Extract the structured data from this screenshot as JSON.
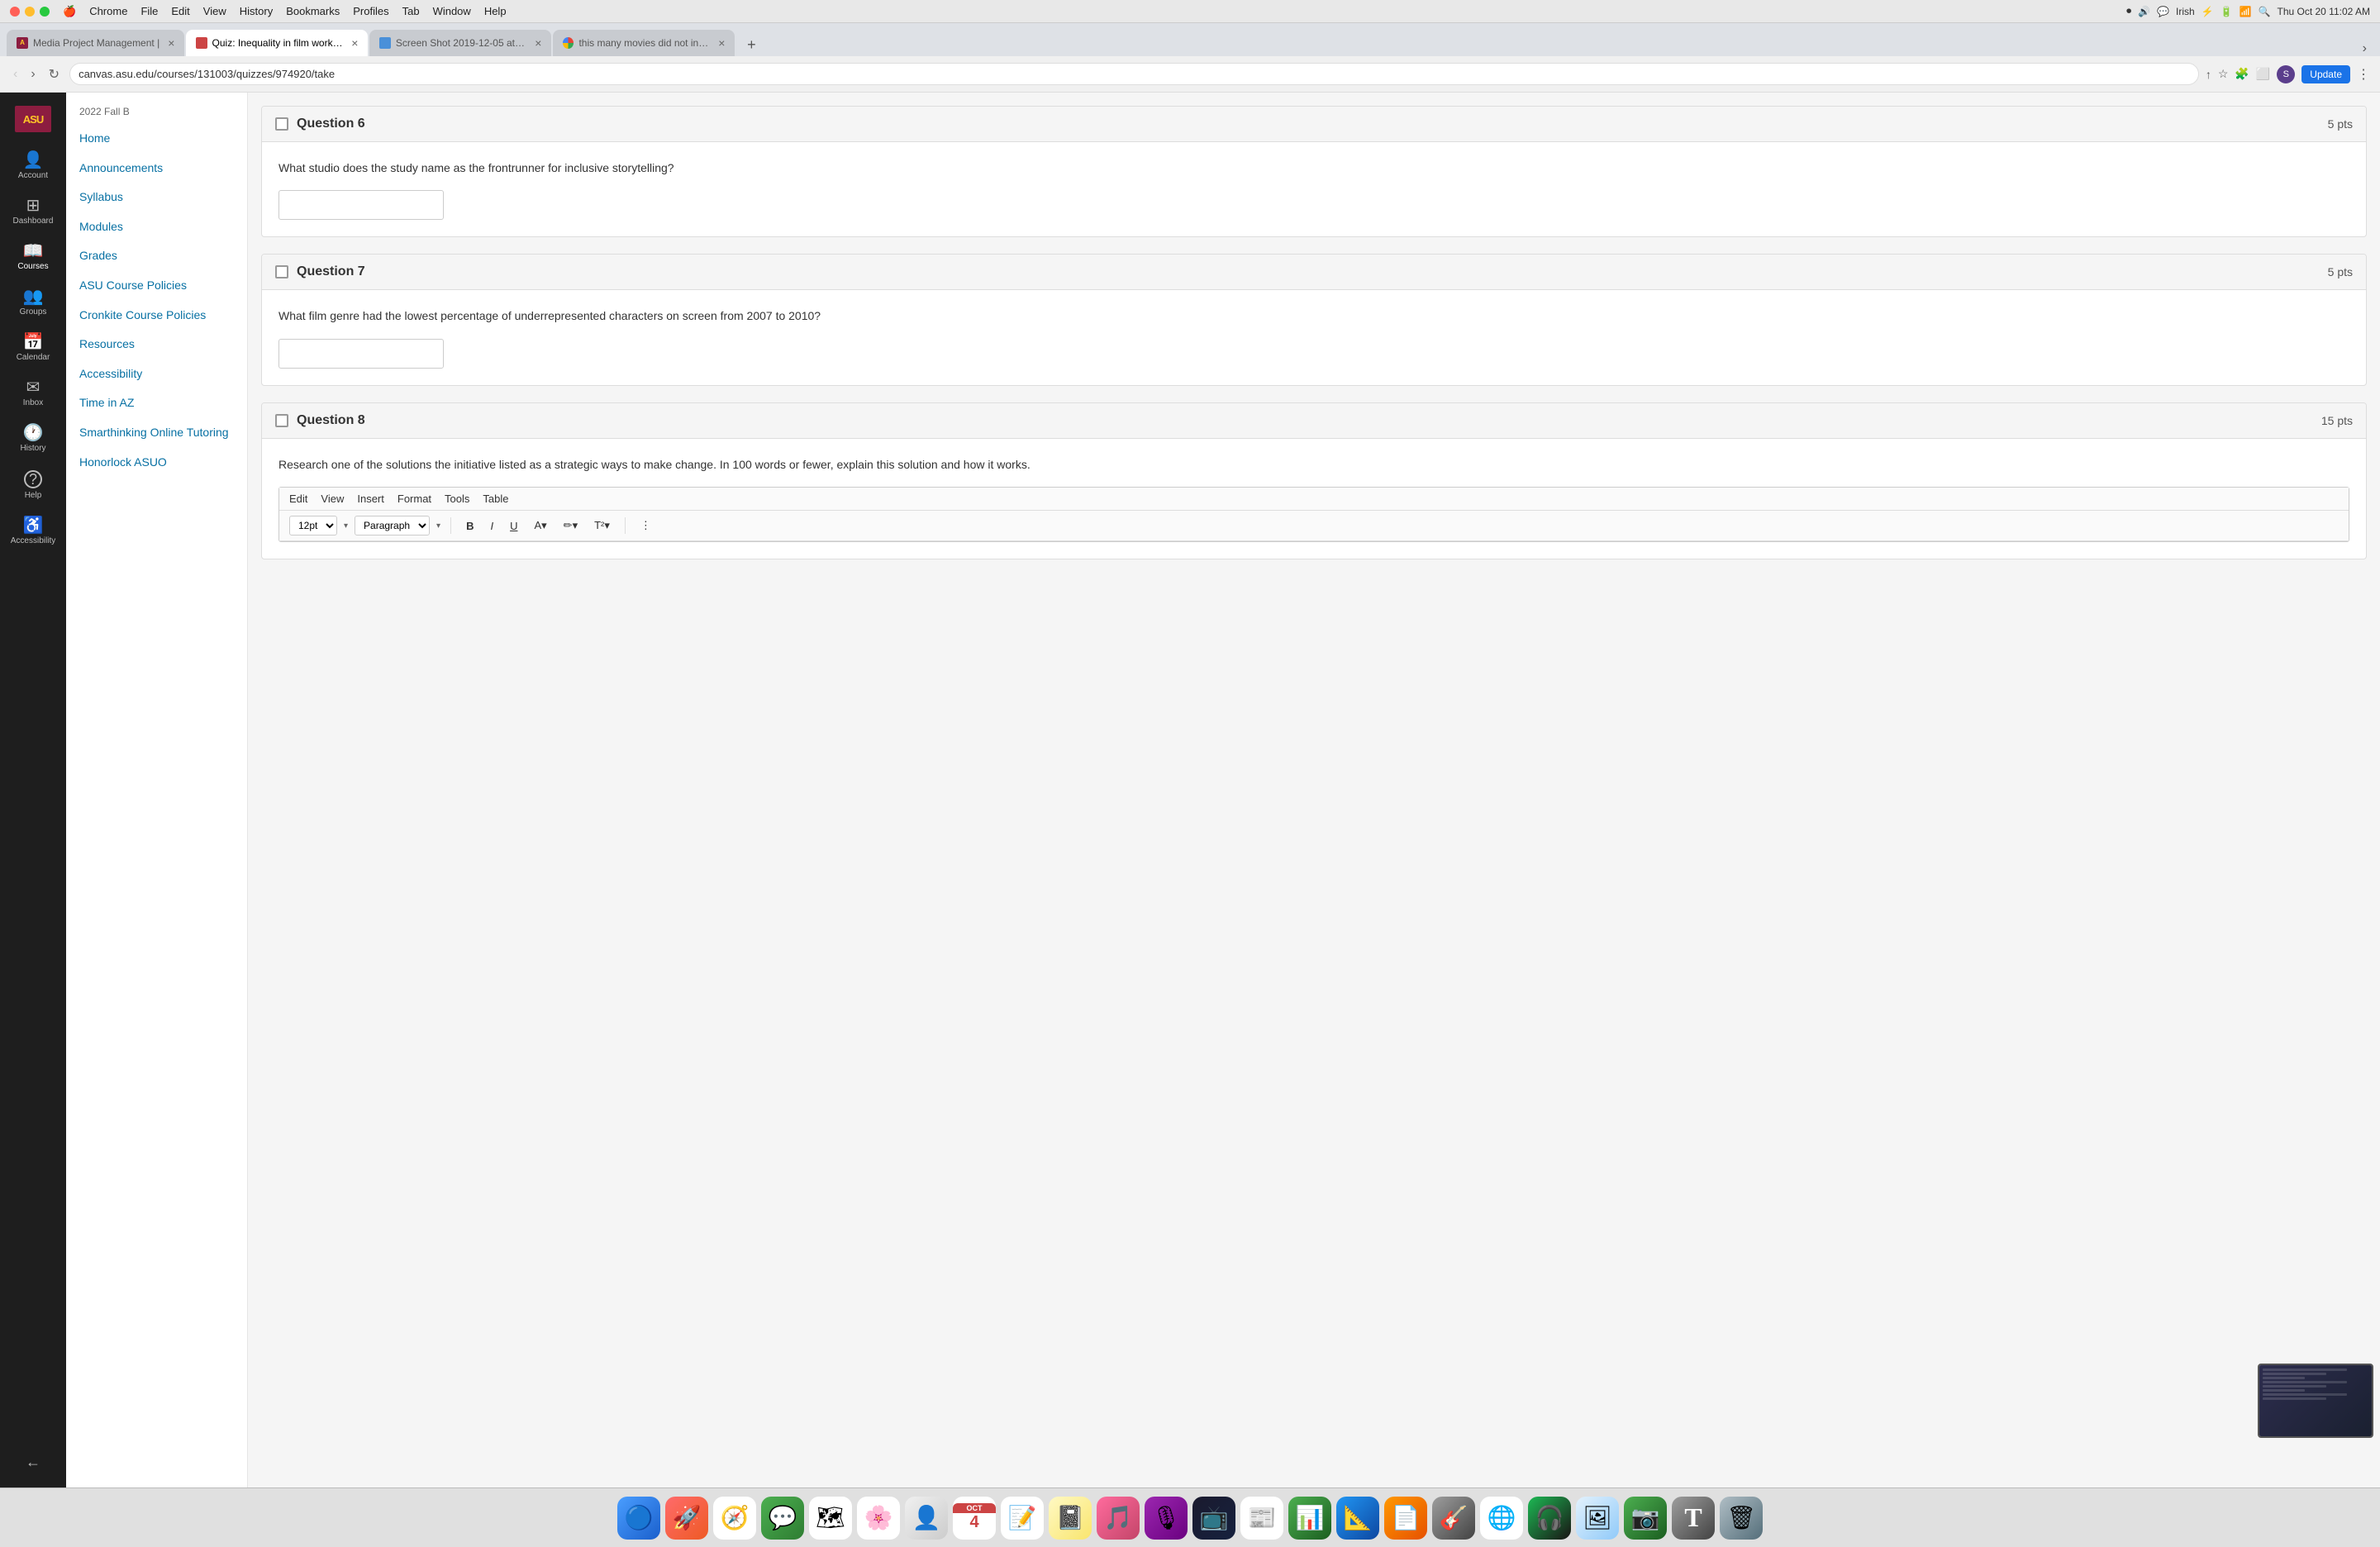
{
  "macos": {
    "menu_items": [
      "Chrome",
      "File",
      "Edit",
      "View",
      "History",
      "Bookmarks",
      "Profiles",
      "Tab",
      "Window",
      "Help"
    ],
    "right_info": "Irish",
    "time": "Thu Oct 20  11:02 AM"
  },
  "browser": {
    "tabs": [
      {
        "id": "tab1",
        "favicon": "asu",
        "title": "Media Project Management |",
        "active": false
      },
      {
        "id": "tab2",
        "favicon": "quiz",
        "title": "Quiz: Inequality in film worksh...",
        "active": true
      },
      {
        "id": "tab3",
        "favicon": "screen",
        "title": "Screen Shot 2019-12-05 at 6...",
        "active": false
      },
      {
        "id": "tab4",
        "favicon": "chrome",
        "title": "this many movies did not inclu...",
        "active": false
      }
    ],
    "address": "canvas.asu.edu/courses/131003/quizzes/974920/take",
    "update_btn": "Update"
  },
  "canvas_nav": {
    "logo": "ASU",
    "items": [
      {
        "id": "account",
        "icon": "👤",
        "label": "Account"
      },
      {
        "id": "dashboard",
        "icon": "⊞",
        "label": "Dashboard"
      },
      {
        "id": "courses",
        "icon": "📖",
        "label": "Courses"
      },
      {
        "id": "groups",
        "icon": "👥",
        "label": "Groups"
      },
      {
        "id": "calendar",
        "icon": "📅",
        "label": "Calendar"
      },
      {
        "id": "inbox",
        "icon": "✉",
        "label": "Inbox"
      },
      {
        "id": "history",
        "icon": "🕐",
        "label": "History"
      },
      {
        "id": "help",
        "icon": "?",
        "label": "Help"
      },
      {
        "id": "accessibility",
        "icon": "♿",
        "label": "Accessibility"
      }
    ]
  },
  "course_sidebar": {
    "semester": "2022 Fall B",
    "nav_items": [
      "Home",
      "Announcements",
      "Syllabus",
      "Modules",
      "Grades",
      "ASU Course Policies",
      "Cronkite Course Policies",
      "Resources",
      "Accessibility",
      "Time in AZ",
      "Smarthinking Online Tutoring",
      "Honorlock ASUO"
    ]
  },
  "questions": [
    {
      "id": "q6",
      "number": "Question 6",
      "pts": "5 pts",
      "text": "What studio does the study name as the frontrunner for inclusive storytelling?",
      "type": "short_answer"
    },
    {
      "id": "q7",
      "number": "Question 7",
      "pts": "5 pts",
      "text": "What film genre had the lowest percentage of underrepresented characters on screen from 2007 to 2010?",
      "type": "short_answer"
    },
    {
      "id": "q8",
      "number": "Question 8",
      "pts": "15 pts",
      "text": "Research one of the solutions the initiative listed as a strategic ways to make change. In 100 words or fewer, explain this solution and how it works.",
      "type": "essay",
      "editor_menu": [
        "Edit",
        "View",
        "Insert",
        "Format",
        "Tools",
        "Table"
      ],
      "font_size": "12pt",
      "paragraph_style": "Paragraph"
    }
  ],
  "dock": {
    "items": [
      {
        "id": "finder",
        "emoji": "🔵",
        "label": "Finder"
      },
      {
        "id": "launchpad",
        "emoji": "🚀",
        "label": "Launchpad"
      },
      {
        "id": "safari",
        "emoji": "🧭",
        "label": "Safari"
      },
      {
        "id": "messages",
        "emoji": "💬",
        "label": "Messages"
      },
      {
        "id": "maps",
        "emoji": "🗺",
        "label": "Maps"
      },
      {
        "id": "photos",
        "emoji": "🌸",
        "label": "Photos"
      },
      {
        "id": "contacts",
        "emoji": "👤",
        "label": "Contacts"
      },
      {
        "id": "calendar",
        "emoji": "📅",
        "label": "Calendar"
      },
      {
        "id": "reminders",
        "emoji": "📝",
        "label": "Reminders"
      },
      {
        "id": "notes",
        "emoji": "📓",
        "label": "Notes"
      },
      {
        "id": "music",
        "emoji": "🎵",
        "label": "Music"
      },
      {
        "id": "podcasts",
        "emoji": "🎙",
        "label": "Podcasts"
      },
      {
        "id": "tv",
        "emoji": "📺",
        "label": "TV"
      },
      {
        "id": "news",
        "emoji": "📰",
        "label": "News"
      },
      {
        "id": "numbers",
        "emoji": "📊",
        "label": "Numbers"
      },
      {
        "id": "keynote",
        "emoji": "📐",
        "label": "Keynote"
      },
      {
        "id": "pages",
        "emoji": "📄",
        "label": "Pages"
      },
      {
        "id": "instruments",
        "emoji": "🎸",
        "label": "Instruments"
      },
      {
        "id": "chrome",
        "emoji": "🌐",
        "label": "Chrome"
      },
      {
        "id": "spotify",
        "emoji": "🎧",
        "label": "Spotify"
      },
      {
        "id": "preview",
        "emoji": "🖼",
        "label": "Preview"
      },
      {
        "id": "facetime",
        "emoji": "📷",
        "label": "FaceTime"
      },
      {
        "id": "fonts",
        "emoji": "T",
        "label": "Fonts"
      },
      {
        "id": "trash",
        "emoji": "🗑",
        "label": "Trash"
      }
    ]
  }
}
